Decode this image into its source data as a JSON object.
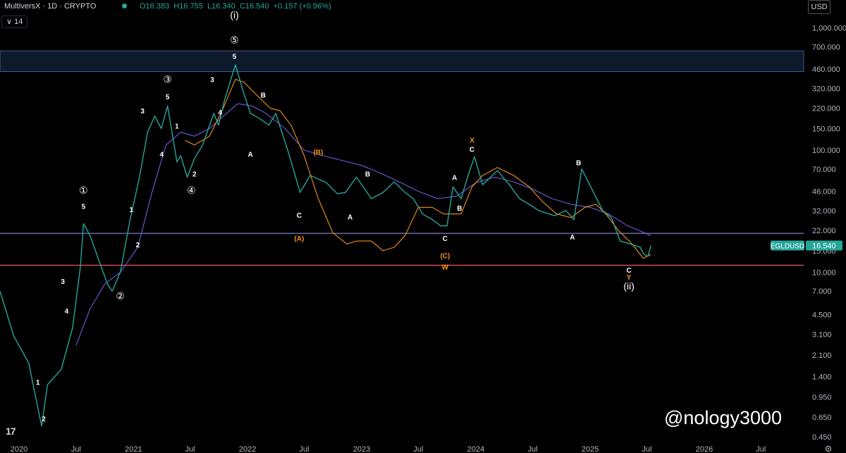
{
  "header": {
    "symbol": "MultiversX · 1D · CRYPTO",
    "ohlc": {
      "o": "O16.383",
      "h": "H16.755",
      "l": "L16.340",
      "c": "C16.540",
      "chg": "+0.157 (+0.96%)"
    },
    "interval_value": "14",
    "interval_caret": "∨",
    "currency": "USD"
  },
  "watermark": "@nology3000",
  "logo": "17",
  "colors": {
    "up": "#26a69a",
    "ma_fast": "#f7931a",
    "ma_slow": "#6e5ce0",
    "line_support": "#ef5350",
    "band": "#1e3a5f"
  },
  "chart_data": {
    "type": "line",
    "symbol": "EGLDUSD",
    "last_price_label": "16.540",
    "y_scale": "log",
    "ylim": [
      0.42,
      1300
    ],
    "xlim": [
      "2019-11-01",
      "2026-11-15"
    ],
    "y_ticks": [
      "1,000.000",
      "700.000",
      "460.000",
      "320.000",
      "220.000",
      "150.000",
      "100.000",
      "70.000",
      "46.000",
      "32.000",
      "22.000",
      "15.000",
      "10.000",
      "7.000",
      "4.500",
      "3.100",
      "2.100",
      "1.400",
      "0.950",
      "0.650",
      "0.450"
    ],
    "y_tick_values": [
      1000,
      700,
      460,
      320,
      220,
      150,
      100,
      70,
      46,
      32,
      22,
      15,
      10,
      7,
      4.5,
      3.1,
      2.1,
      1.4,
      0.95,
      0.65,
      0.45
    ],
    "x_ticks": [
      {
        "label": "2020",
        "date": "2020-01-01"
      },
      {
        "label": "Jul",
        "date": "2020-07-01"
      },
      {
        "label": "2021",
        "date": "2021-01-01"
      },
      {
        "label": "Jul",
        "date": "2021-07-01"
      },
      {
        "label": "2022",
        "date": "2022-01-01"
      },
      {
        "label": "Jul",
        "date": "2022-07-01"
      },
      {
        "label": "2023",
        "date": "2023-01-01"
      },
      {
        "label": "Jul",
        "date": "2023-07-01"
      },
      {
        "label": "2024",
        "date": "2024-01-01"
      },
      {
        "label": "Jul",
        "date": "2024-07-01"
      },
      {
        "label": "2025",
        "date": "2025-01-01"
      },
      {
        "label": "Jul",
        "date": "2025-07-01"
      },
      {
        "label": "2026",
        "date": "2026-01-01"
      },
      {
        "label": "Jul",
        "date": "2026-07-01"
      }
    ],
    "price": {
      "x": [
        "2019-11-01",
        "2019-12-15",
        "2020-02-01",
        "2020-03-13",
        "2020-04-01",
        "2020-05-15",
        "2020-06-20",
        "2020-07-15",
        "2020-07-25",
        "2020-08-15",
        "2020-09-10",
        "2020-10-10",
        "2020-10-25",
        "2020-11-20",
        "2020-12-20",
        "2021-01-20",
        "2021-02-15",
        "2021-03-10",
        "2021-03-31",
        "2021-04-20",
        "2021-05-20",
        "2021-06-01",
        "2021-06-22",
        "2021-07-15",
        "2021-08-10",
        "2021-09-15",
        "2021-09-30",
        "2021-10-20",
        "2021-11-23",
        "2021-12-20",
        "2022-01-10",
        "2022-02-10",
        "2022-03-10",
        "2022-04-01",
        "2022-05-12",
        "2022-06-18",
        "2022-07-20",
        "2022-08-15",
        "2022-09-10",
        "2022-10-15",
        "2022-11-10",
        "2022-12-15",
        "2023-02-01",
        "2023-03-10",
        "2023-04-15",
        "2023-05-20",
        "2023-06-15",
        "2023-07-15",
        "2023-08-15",
        "2023-09-10",
        "2023-10-01",
        "2023-10-20",
        "2023-11-15",
        "2023-12-10",
        "2023-12-28",
        "2024-01-23",
        "2024-03-10",
        "2024-04-20",
        "2024-05-20",
        "2024-06-20",
        "2024-07-20",
        "2024-08-05",
        "2024-09-10",
        "2024-10-15",
        "2024-11-10",
        "2024-12-05",
        "2025-01-10",
        "2025-02-10",
        "2025-03-10",
        "2025-04-07",
        "2025-05-10",
        "2025-06-10",
        "2025-06-22",
        "2025-07-05",
        "2025-07-14"
      ],
      "y": [
        7,
        3,
        1.8,
        0.55,
        1.2,
        1.6,
        3.5,
        11,
        25,
        20,
        13,
        8,
        7,
        10,
        26,
        60,
        140,
        190,
        150,
        230,
        80,
        90,
        60,
        85,
        110,
        200,
        160,
        260,
        500,
        290,
        200,
        180,
        160,
        200,
        95,
        45,
        62,
        58,
        54,
        44,
        45,
        60,
        40,
        45,
        55,
        45,
        40,
        30,
        27,
        24,
        24,
        50,
        40,
        65,
        88,
        52,
        68,
        51,
        40,
        36,
        32,
        31,
        29,
        32,
        27,
        70,
        46,
        32,
        28,
        18,
        17,
        16,
        14,
        13.5,
        16.54
      ]
    },
    "ma_fast": {
      "x": [
        "2021-06-15",
        "2021-07-15",
        "2021-09-01",
        "2021-10-15",
        "2021-11-23",
        "2021-12-20",
        "2022-02-01",
        "2022-03-15",
        "2022-04-15",
        "2022-05-20",
        "2022-07-01",
        "2022-08-15",
        "2022-10-01",
        "2022-11-15",
        "2022-12-15",
        "2023-02-01",
        "2023-03-10",
        "2023-04-15",
        "2023-05-20",
        "2023-07-01",
        "2023-08-15",
        "2023-09-20",
        "2023-11-15",
        "2023-12-20",
        "2024-01-23",
        "2024-03-10",
        "2024-05-01",
        "2024-06-20",
        "2024-08-01",
        "2024-09-15",
        "2024-11-01",
        "2024-12-15",
        "2025-01-20",
        "2025-02-20",
        "2025-04-01",
        "2025-05-15",
        "2025-06-20",
        "2025-07-14"
      ],
      "y": [
        120,
        110,
        130,
        220,
        380,
        360,
        280,
        220,
        210,
        160,
        90,
        40,
        21,
        17,
        18,
        18,
        15,
        16,
        20,
        34,
        34,
        30,
        30,
        50,
        62,
        72,
        62,
        50,
        38,
        30,
        28,
        34,
        36,
        30,
        22,
        17,
        13,
        14
      ]
    },
    "ma_slow": {
      "x": [
        "2020-07-01",
        "2020-08-15",
        "2020-10-01",
        "2020-11-20",
        "2021-01-15",
        "2021-03-01",
        "2021-04-15",
        "2021-06-01",
        "2021-07-15",
        "2021-09-01",
        "2021-10-15",
        "2021-12-01",
        "2022-01-15",
        "2022-03-01",
        "2022-05-01",
        "2022-07-01",
        "2022-09-01",
        "2022-11-01",
        "2023-01-01",
        "2023-03-01",
        "2023-05-01",
        "2023-07-01",
        "2023-09-01",
        "2023-11-01",
        "2024-01-01",
        "2024-03-01",
        "2024-05-01",
        "2024-07-01",
        "2024-09-01",
        "2024-11-01",
        "2025-01-01",
        "2025-03-01",
        "2025-05-01",
        "2025-07-14"
      ],
      "y": [
        2.5,
        5,
        8,
        10,
        16,
        45,
        110,
        140,
        130,
        150,
        190,
        240,
        230,
        200,
        150,
        100,
        90,
        82,
        75,
        65,
        55,
        46,
        40,
        42,
        54,
        60,
        55,
        48,
        40,
        36,
        34,
        30,
        24,
        20
      ]
    },
    "hlines": [
      {
        "name": "resistance-band",
        "y_top": 650,
        "y_bottom": 440
      },
      {
        "name": "level-purple",
        "y": 20.8
      },
      {
        "name": "level-red",
        "y": 11.4
      }
    ],
    "annotations": [
      {
        "t": "2",
        "x": "2020-03-20",
        "y": 0.6,
        "c": "w"
      },
      {
        "t": "1",
        "x": "2020-03-01",
        "y": 1.2,
        "c": "w"
      },
      {
        "t": "4",
        "x": "2020-06-01",
        "y": 4.6,
        "c": "w"
      },
      {
        "t": "3",
        "x": "2020-05-20",
        "y": 8,
        "c": "w"
      },
      {
        "t": "5",
        "x": "2020-07-25",
        "y": 33,
        "c": "w"
      },
      {
        "t": "①",
        "x": "2020-07-25",
        "y": 44,
        "c": "w",
        "big": true
      },
      {
        "t": "②",
        "x": "2020-11-20",
        "y": 6,
        "c": "w",
        "big": true
      },
      {
        "t": "2",
        "x": "2021-01-15",
        "y": 16,
        "c": "w"
      },
      {
        "t": "1",
        "x": "2020-12-25",
        "y": 31,
        "c": "w"
      },
      {
        "t": "3",
        "x": "2021-01-30",
        "y": 200,
        "c": "w"
      },
      {
        "t": "4",
        "x": "2021-04-01",
        "y": 88,
        "c": "w"
      },
      {
        "t": "5",
        "x": "2021-04-20",
        "y": 260,
        "c": "w"
      },
      {
        "t": "③",
        "x": "2021-04-20",
        "y": 355,
        "c": "w",
        "big": true
      },
      {
        "t": "1",
        "x": "2021-05-20",
        "y": 150,
        "c": "w"
      },
      {
        "t": "2",
        "x": "2021-07-15",
        "y": 61,
        "c": "w"
      },
      {
        "t": "④",
        "x": "2021-07-05",
        "y": 44,
        "c": "w",
        "big": true
      },
      {
        "t": "3",
        "x": "2021-09-10",
        "y": 360,
        "c": "w"
      },
      {
        "t": "4",
        "x": "2021-10-05",
        "y": 195,
        "c": "w"
      },
      {
        "t": "5",
        "x": "2021-11-20",
        "y": 560,
        "c": "w"
      },
      {
        "t": "⑤",
        "x": "2021-11-20",
        "y": 750,
        "c": "w",
        "big": true
      },
      {
        "t": "(i)",
        "x": "2021-11-20",
        "y": 1200,
        "c": "w",
        "big": true
      },
      {
        "t": "A",
        "x": "2022-01-10",
        "y": 88,
        "c": "w"
      },
      {
        "t": "B",
        "x": "2022-02-20",
        "y": 270,
        "c": "w"
      },
      {
        "t": "(B)",
        "x": "2022-08-15",
        "y": 92,
        "c": "o"
      },
      {
        "t": "C",
        "x": "2022-06-15",
        "y": 28,
        "c": "w"
      },
      {
        "t": "(A)",
        "x": "2022-06-15",
        "y": 18,
        "c": "o"
      },
      {
        "t": "B",
        "x": "2023-01-20",
        "y": 61,
        "c": "w"
      },
      {
        "t": "A",
        "x": "2022-11-25",
        "y": 27,
        "c": "w"
      },
      {
        "t": "A",
        "x": "2023-10-25",
        "y": 57,
        "c": "w"
      },
      {
        "t": "B",
        "x": "2023-11-10",
        "y": 32,
        "c": "w"
      },
      {
        "t": "C",
        "x": "2023-09-25",
        "y": 18,
        "c": "w"
      },
      {
        "t": "(C)",
        "x": "2023-09-25",
        "y": 13,
        "c": "o"
      },
      {
        "t": "W",
        "x": "2023-09-25",
        "y": 10.5,
        "c": "o"
      },
      {
        "t": "X",
        "x": "2023-12-20",
        "y": 115,
        "c": "o"
      },
      {
        "t": "C",
        "x": "2023-12-20",
        "y": 97,
        "c": "w"
      },
      {
        "t": "B",
        "x": "2024-11-25",
        "y": 75,
        "c": "w"
      },
      {
        "t": "A",
        "x": "2024-11-05",
        "y": 18.5,
        "c": "w"
      },
      {
        "t": "C",
        "x": "2025-05-05",
        "y": 9.9,
        "c": "w"
      },
      {
        "t": "Y",
        "x": "2025-05-05",
        "y": 8.7,
        "c": "o"
      },
      {
        "t": "(ii)",
        "x": "2025-05-05",
        "y": 7.2,
        "c": "w",
        "big": true
      }
    ]
  }
}
